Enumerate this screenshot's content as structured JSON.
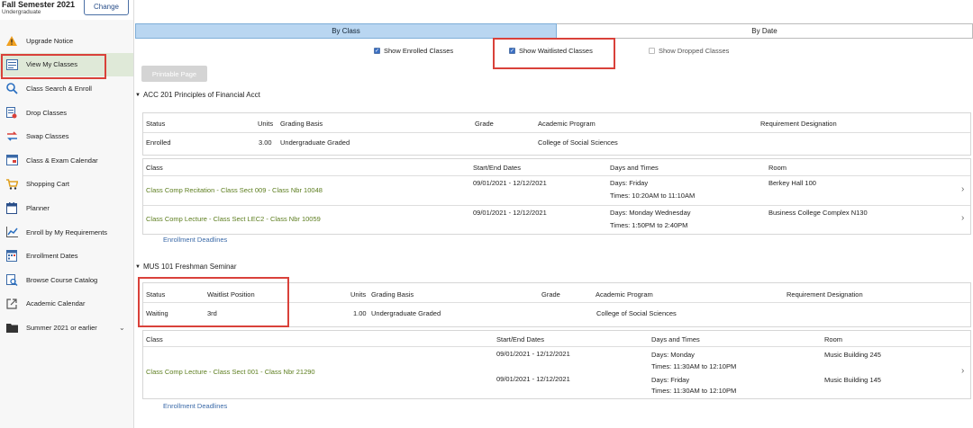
{
  "term": {
    "title": "Fall Semester 2021",
    "subtitle": "Undergraduate",
    "change_label": "Change"
  },
  "sidebar": {
    "items": [
      {
        "label": "Upgrade Notice",
        "icon": "warning-icon"
      },
      {
        "label": "View My Classes",
        "icon": "class-list-icon"
      },
      {
        "label": "Class Search & Enroll",
        "icon": "search-icon"
      },
      {
        "label": "Drop Classes",
        "icon": "drop-icon"
      },
      {
        "label": "Swap Classes",
        "icon": "swap-icon"
      },
      {
        "label": "Class & Exam Calendar",
        "icon": "calendar-icon"
      },
      {
        "label": "Shopping Cart",
        "icon": "cart-icon"
      },
      {
        "label": "Planner",
        "icon": "planner-icon"
      },
      {
        "label": "Enroll by My Requirements",
        "icon": "chart-icon"
      },
      {
        "label": "Enrollment Dates",
        "icon": "dates-icon"
      },
      {
        "label": "Browse Course Catalog",
        "icon": "catalog-icon"
      },
      {
        "label": "Academic Calendar",
        "icon": "external-link-icon"
      },
      {
        "label": "Summer 2021 or earlier",
        "icon": "folder-icon"
      }
    ]
  },
  "tabs": {
    "by_class": "By Class",
    "by_date": "By Date"
  },
  "filters": {
    "enrolled": "Show Enrolled Classes",
    "waitlisted": "Show Waitlisted Classes",
    "dropped": "Show Dropped Classes"
  },
  "print_label": "Printable Page",
  "courses": [
    {
      "title": "ACC 201 Principles of Financial Acct",
      "summary_headers": {
        "status": "Status",
        "units": "Units",
        "grading": "Grading Basis",
        "grade": "Grade",
        "program": "Academic Program",
        "requirement": "Requirement Designation"
      },
      "summary": {
        "status": "Enrolled",
        "units": "3.00",
        "grading": "Undergraduate Graded",
        "program": "College of Social Sciences"
      },
      "class_headers": {
        "class": "Class",
        "dates": "Start/End Dates",
        "days": "Days and Times",
        "room": "Room"
      },
      "sections": [
        {
          "name": "Class Comp Recitation - Class Sect 009 - Class Nbr 10048",
          "dates": "09/01/2021 - 12/12/2021",
          "days": "Days: Friday",
          "times": "Times: 10:20AM to 11:10AM",
          "room": "Berkey Hall 100"
        },
        {
          "name": "Class Comp Lecture - Class Sect LEC2 - Class Nbr 10059",
          "dates": "09/01/2021 - 12/12/2021",
          "days": "Days: Monday Wednesday",
          "times": "Times: 1:50PM to 2:40PM",
          "room": "Business College Complex N130"
        }
      ],
      "deadline": "Enrollment Deadlines"
    },
    {
      "title": "MUS 101 Freshman Seminar",
      "summary_headers": {
        "status": "Status",
        "waitlist": "Waitlist Position",
        "units": "Units",
        "grading": "Grading Basis",
        "grade": "Grade",
        "program": "Academic Program",
        "requirement": "Requirement Designation"
      },
      "summary": {
        "status": "Waiting",
        "waitlist": "3rd",
        "units": "1.00",
        "grading": "Undergraduate Graded",
        "program": "College of Social Sciences"
      },
      "class_headers": {
        "class": "Class",
        "dates": "Start/End Dates",
        "days": "Days and Times",
        "room": "Room"
      },
      "section": {
        "name": "Class Comp Lecture - Class Sect 001 - Class Nbr 21290",
        "meetings": [
          {
            "dates": "09/01/2021 - 12/12/2021",
            "days": "Days: Monday",
            "times": "Times: 11:30AM to 12:10PM",
            "room": "Music Building 245"
          },
          {
            "dates": "09/01/2021 - 12/12/2021",
            "days": "Days: Friday",
            "times": "Times: 11:30AM to 12:10PM",
            "room": "Music Building 145"
          }
        ]
      },
      "deadline": "Enrollment Deadlines"
    }
  ],
  "colors": {
    "accent": "#b9d6f1",
    "highlight": "#d9413a",
    "link": "#5c7d1e",
    "deadline_link": "#3b6aa8"
  }
}
